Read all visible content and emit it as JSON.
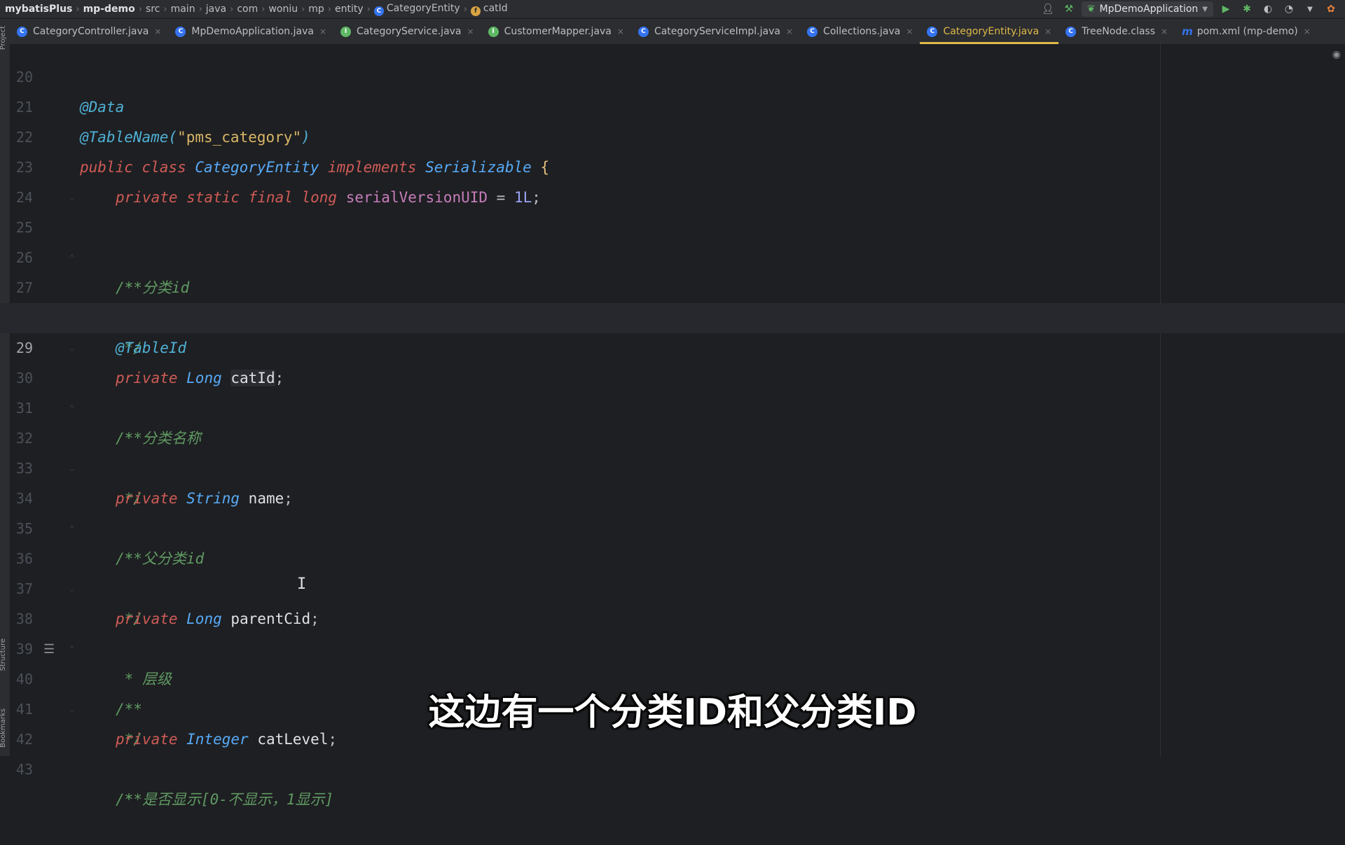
{
  "breadcrumb": [
    "mybatisPlus",
    "mp-demo",
    "src",
    "main",
    "java",
    "com",
    "woniu",
    "mp",
    "entity",
    "CategoryEntity",
    "catId"
  ],
  "run_config": "MpDemoApplication",
  "tabs": [
    {
      "label": "CategoryController.java",
      "icon": "class-icon",
      "active": false
    },
    {
      "label": "MpDemoApplication.java",
      "icon": "class-icon",
      "active": false
    },
    {
      "label": "CategoryService.java",
      "icon": "interface-icon",
      "active": false
    },
    {
      "label": "CustomerMapper.java",
      "icon": "interface-icon",
      "active": false
    },
    {
      "label": "CategoryServiceImpl.java",
      "icon": "class-icon",
      "active": false
    },
    {
      "label": "Collections.java",
      "icon": "class-icon",
      "active": false
    },
    {
      "label": "CategoryEntity.java",
      "icon": "class-icon",
      "active": true
    },
    {
      "label": "TreeNode.class",
      "icon": "class-icon",
      "active": false
    },
    {
      "label": "pom.xml (mp-demo)",
      "icon": "maven-icon",
      "active": false
    }
  ],
  "side_labels": {
    "project": "Project",
    "structure": "Structure",
    "bookmarks": "Bookmarks"
  },
  "editor": {
    "current_line": 29,
    "lines": [
      {
        "n": "20",
        "t": "@Data"
      },
      {
        "n": "21",
        "t1": "@TableName(",
        "t2": "\"pms_category\"",
        "t3": ")"
      },
      {
        "n": "22",
        "k1": "public class ",
        "c": "CategoryEntity ",
        "k2": "implements ",
        "i": "Serializable ",
        "b": "{"
      },
      {
        "n": "23",
        "k": "private static final long ",
        "f": "serialVersionUID",
        "o": " = ",
        "v": "1L",
        "p": ";"
      },
      {
        "n": "24"
      },
      {
        "n": "25",
        "cm": "/**"
      },
      {
        "n": "26",
        "cm": " * 分类id"
      },
      {
        "n": "27",
        "cm": " */"
      },
      {
        "n": "28",
        "a": "@TableId"
      },
      {
        "n": "29",
        "k": "private ",
        "ty": "Long ",
        "id": "catId",
        "p": ";"
      },
      {
        "n": "30",
        "cm": "/**"
      },
      {
        "n": "31",
        "cm": " * 分类名称"
      },
      {
        "n": "32",
        "cm": " */"
      },
      {
        "n": "33",
        "k": "private ",
        "ty": "String ",
        "id": "name",
        "p": ";"
      },
      {
        "n": "34",
        "cm": "/**"
      },
      {
        "n": "35",
        "cm": " * 父分类id"
      },
      {
        "n": "36",
        "cm": " */"
      },
      {
        "n": "37",
        "k": "private ",
        "ty": "Long ",
        "id": "parentCid",
        "p": ";"
      },
      {
        "n": "38",
        "cm": "/**"
      },
      {
        "n": "39",
        "cm": " * 层级"
      },
      {
        "n": "40",
        "cm": " */"
      },
      {
        "n": "41",
        "k": "private ",
        "ty": "Integer ",
        "id": "catLevel",
        "p": ";"
      },
      {
        "n": "42",
        "cm": "/**"
      },
      {
        "n": "43",
        "cm": " * 是否显示[0-不显示，1显示]"
      }
    ]
  },
  "subtitle": "这边有一个分类ID和父分类ID"
}
